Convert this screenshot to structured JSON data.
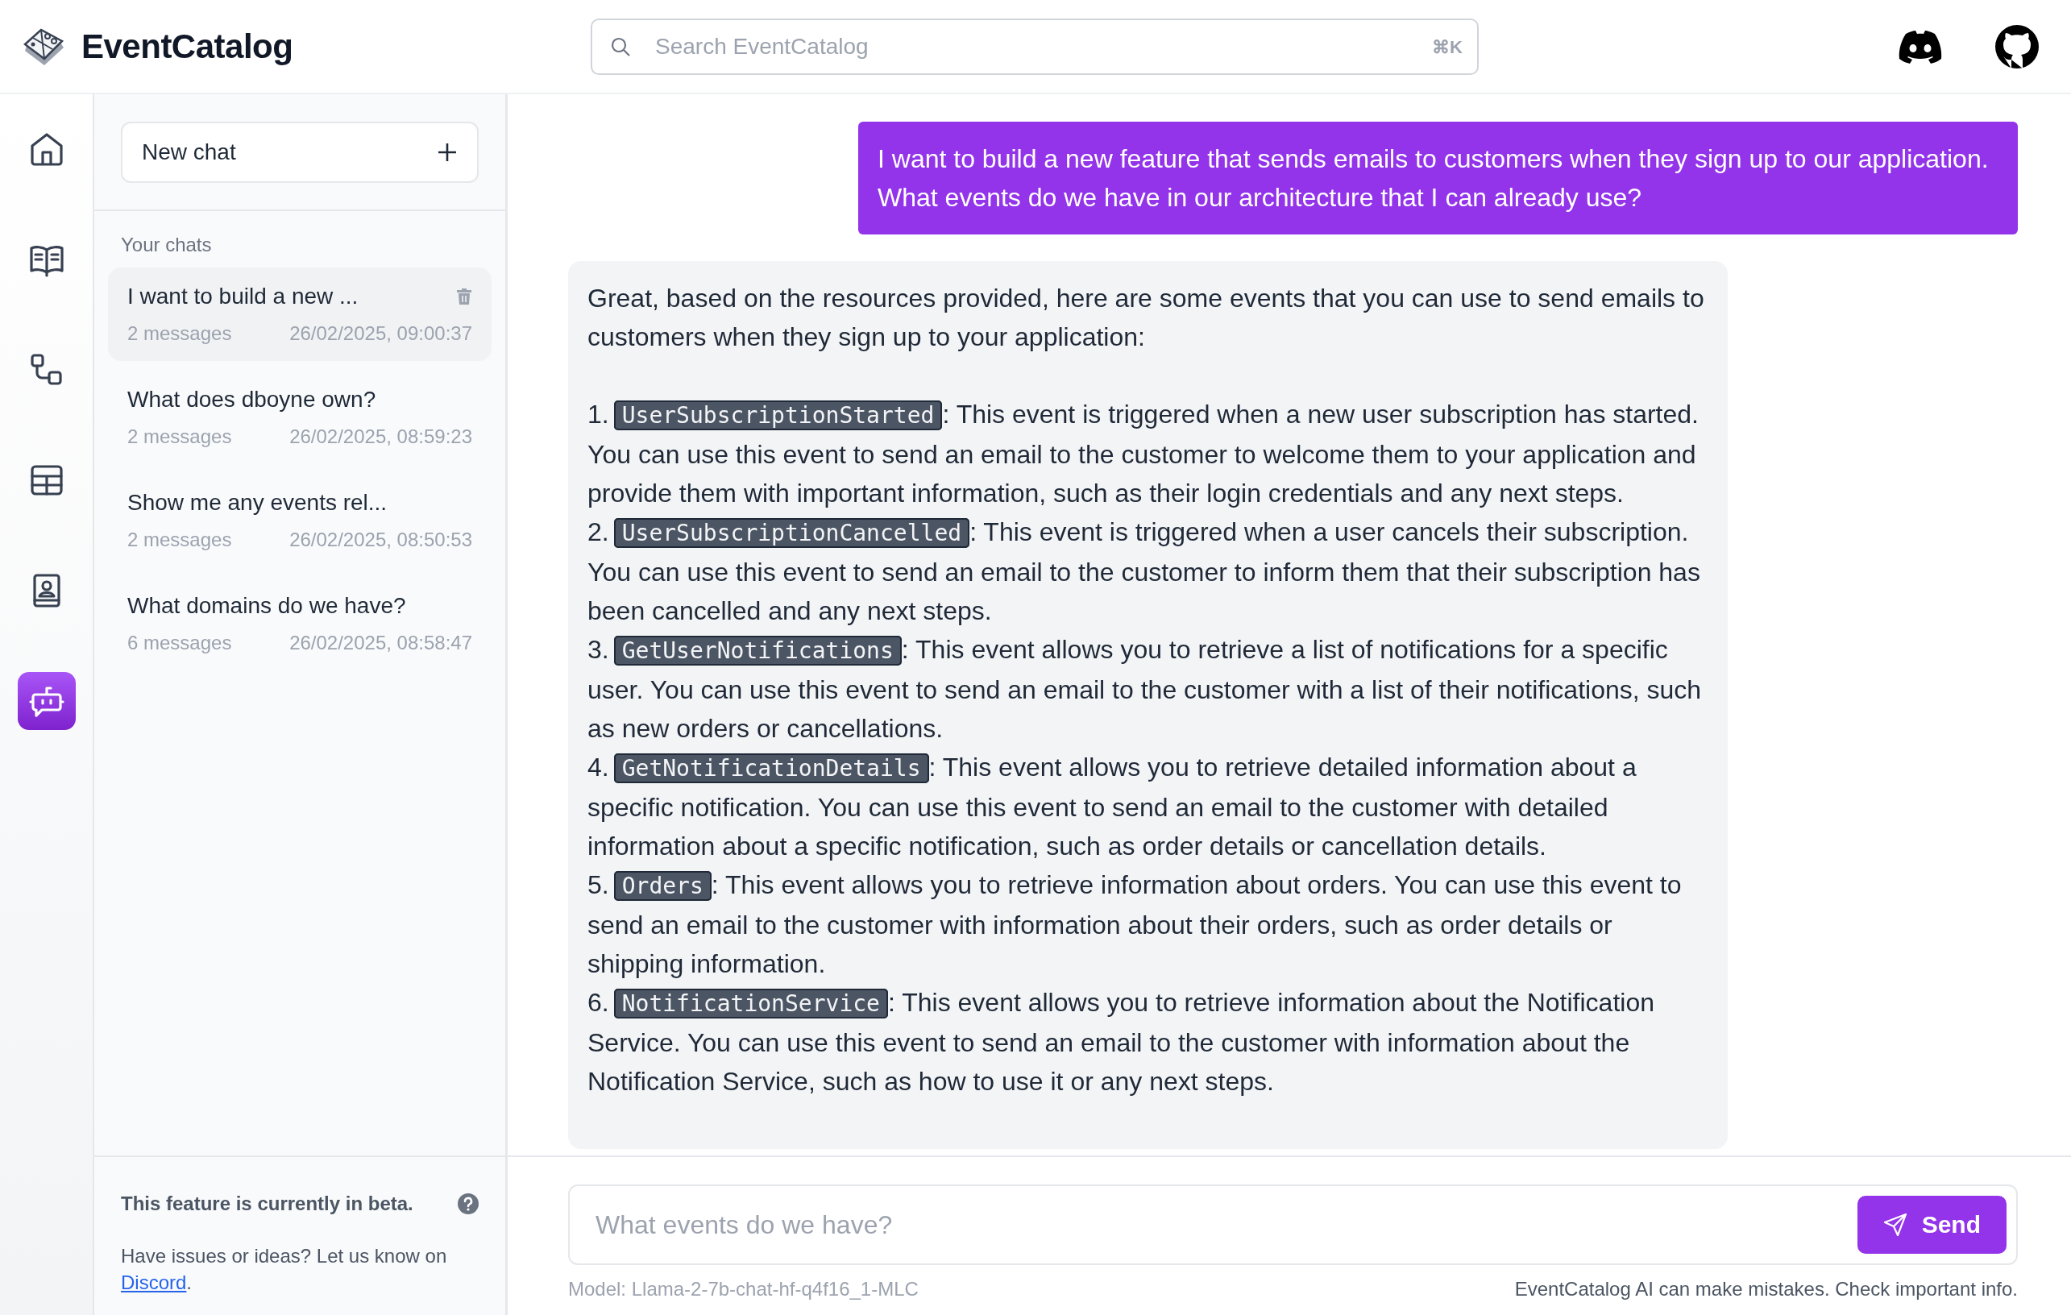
{
  "header": {
    "title": "EventCatalog",
    "search": {
      "placeholder": "Search EventCatalog",
      "shortcut": "⌘K"
    }
  },
  "nav": [
    {
      "kind": "home",
      "selected": false
    },
    {
      "kind": "docs",
      "selected": false
    },
    {
      "kind": "flows",
      "selected": false
    },
    {
      "kind": "table",
      "selected": false
    },
    {
      "kind": "directory",
      "selected": false
    },
    {
      "kind": "chat",
      "selected": true
    }
  ],
  "chats": {
    "new_chat": "New chat",
    "heading": "Your chats",
    "items": [
      {
        "title": "I want to build a new ...",
        "count": "2 messages",
        "time": "26/02/2025, 09:00:37",
        "selected": true
      },
      {
        "title": "What does dboyne own?",
        "count": "2 messages",
        "time": "26/02/2025, 08:59:23",
        "selected": false
      },
      {
        "title": "Show me any events rel...",
        "count": "2 messages",
        "time": "26/02/2025, 08:50:53",
        "selected": false
      },
      {
        "title": "What domains do we have?",
        "count": "6 messages",
        "time": "26/02/2025, 08:58:47",
        "selected": false
      }
    ]
  },
  "beta": {
    "title": "This feature is currently in beta.",
    "text": "Have issues or ideas? Let us know on",
    "link": "Discord",
    "after": "."
  },
  "messages": [
    {
      "kind": "user",
      "text": "I want to build a new feature that sends emails to customers when they sign up to our application. What events do we have in our architecture that I can already use?"
    },
    {
      "kind": "assistant",
      "intro": "Great, based on the resources provided, here are some events that you can use to send emails to customers when they sign up to your application:",
      "items": [
        {
          "number": "1.",
          "code": "UserSubscriptionStarted",
          "text": ": This event is triggered when a new user subscription has started. You can use this event to send an email to the customer to welcome them to your application and provide them with important information, such as their login credentials and any next steps."
        },
        {
          "number": "2.",
          "code": "UserSubscriptionCancelled",
          "text": ": This event is triggered when a user cancels their subscription. You can use this event to send an email to the customer to inform them that their subscription has been cancelled and any next steps."
        },
        {
          "number": "3.",
          "code": "GetUserNotifications",
          "text": ": This event allows you to retrieve a list of notifications for a specific user. You can use this event to send an email to the customer with a list of their notifications, such as new orders or cancellations."
        },
        {
          "number": "4.",
          "code": "GetNotificationDetails",
          "text": ": This event allows you to retrieve detailed information about a specific notification. You can use this event to send an email to the customer with detailed information about a specific notification, such as order details or cancellation details."
        },
        {
          "number": "5.",
          "code": "Orders",
          "text": ": This event allows you to retrieve information about orders. You can use this event to send an email to the customer with information about their orders, such as order details or shipping information."
        },
        {
          "number": "6.",
          "code": "NotificationService",
          "text": ": This event allows you to retrieve information about the Notification Service. You can use this event to send an email to the customer with information about the Notification Service, such as how to use it or any next steps."
        }
      ]
    }
  ],
  "composer": {
    "placeholder": "What events do we have?",
    "send": "Send",
    "model": "Model: Llama-2-7b-chat-hf-q4f16_1-MLC",
    "disclaimer": "EventCatalog AI can make mistakes. Check important info."
  }
}
